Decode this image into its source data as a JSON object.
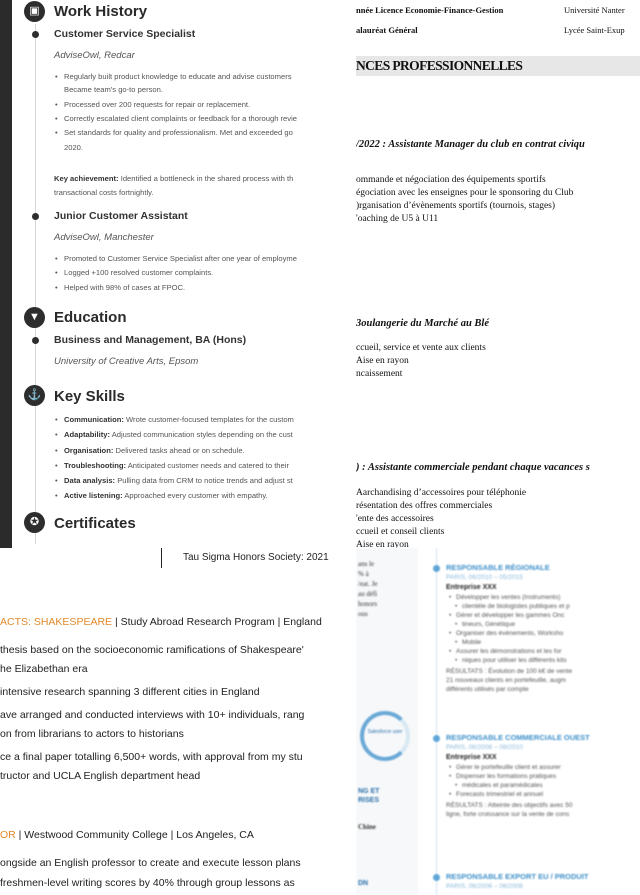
{
  "panelA": {
    "work": {
      "heading": "Work History",
      "job1": {
        "title": "Customer Service Specialist",
        "company": "AdviseOwl, Redcar",
        "bullets": [
          "Regularly built product knowledge to educate and advise customers",
          "Became team's go-to person.",
          "Processed over 200 requests for repair or replacement.",
          "Correctly escalated client complaints or feedback for a thorough revie",
          "Set standards for quality and professionalism. Met and exceeded go",
          "2020."
        ],
        "achievement_label": "Key achievement:",
        "achievement_text": "Identified a bottleneck in the shared process with th",
        "achievement_text2": "transactional costs fortnightly."
      },
      "job2": {
        "title": "Junior Customer Assistant",
        "company": "AdviseOwl, Manchester",
        "bullets": [
          "Promoted to Customer Service Specialist after one year of employme",
          "Logged +100 resolved customer complaints.",
          "Helped with 98% of cases at FPOC."
        ]
      }
    },
    "education": {
      "heading": "Education",
      "degree": "Business and Management, BA (Hons)",
      "school": "University of Creative Arts, Epsom"
    },
    "skills": {
      "heading": "Key Skills",
      "items": [
        {
          "label": "Communication:",
          "text": "Wrote customer-focused templates for the custom"
        },
        {
          "label": "Adaptability:",
          "text": "Adjusted communication styles depending on the cust"
        },
        {
          "label": "Organisation:",
          "text": "Delivered tasks ahead or on schedule."
        },
        {
          "label": "Troubleshooting:",
          "text": "Anticipated customer needs and catered to their"
        },
        {
          "label": "Data analysis:",
          "text": "Pulling data from CRM to notice trends and adjust st"
        },
        {
          "label": "Active listening:",
          "text": "Approached every customer with empathy."
        }
      ]
    },
    "certificates": {
      "heading": "Certificates"
    },
    "icons": {
      "work": "briefcase-icon",
      "education": "graduation-cap-icon",
      "skills": "anchor-icon",
      "certificates": "award-icon"
    }
  },
  "panelB": {
    "edu1_left": "nnée Licence Economie-Finance-Gestion",
    "edu1_right": "Université Nanter",
    "edu2_left": "alauréat Général",
    "edu2_right": "Lycée Saint-Exup",
    "section": "NCES PROFESSIONNELLES",
    "job1_title": "/2022 : Assistante Manager du club en contrat civiqu",
    "job1_lines": [
      "ommande et négociation des équipements sportifs",
      "égociation avec les enseignes pour le sponsoring du Club",
      ")rganisation d’évènements sportifs (tournois, stages)",
      "'oaching de U5 à U11"
    ],
    "job2_title": "3oulangerie du Marché au Blé",
    "job2_lines": [
      "ccueil, service et vente aux clients",
      "Aise en rayon",
      "ncaissement"
    ],
    "job3_title": ") : Assistante commerciale pendant chaque vacances s",
    "job3_lines": [
      "Aarchandising d’accessoires pour téléphonie",
      "résentation des offres commerciales",
      "'ente des accessoires",
      "ccueil et conseil clients",
      "Aise en rayon"
    ]
  },
  "panelC": {
    "honors": "Tau Sigma Honors Society: 2021",
    "role_accent": "ACTS: SHAKESPEARE",
    "role_rest": " | Study Abroad Research Program | England",
    "lines": [
      "thesis based on the socioeconomic ramifications of Shakespeare'",
      "he Elizabethan era",
      "intensive research spanning 3 different cities in England",
      "ave arranged and conducted interviews with 10+ individuals, rang",
      "on from librarians to actors to historians",
      "ce a final paper totalling 6,500+ words, with approval from my stu",
      "tructor and UCLA English department head"
    ],
    "role2_accent": "OR",
    "role2_rest": " | Westwood Community College | Los Angeles, CA",
    "lines2": [
      "ongside an English professor to create and execute lesson plans",
      "freshmen-level writing scores by 40% through group lessons as"
    ]
  },
  "panelD": {
    "sidebar_frags": [
      "ans le",
      "% à",
      "/eat. Je",
      "au défi",
      "honors",
      "ous"
    ],
    "circle_label": "Salesforce user",
    "sidebar_caps": [
      "NG ET",
      "RISES"
    ],
    "sidebar_more": [
      "Chine",
      "DN"
    ],
    "entries": [
      {
        "title": "RESPONSABLE RÉGIONALE",
        "dates": "PARIS, 06/2010 – 05/2015",
        "company": "Entreprise XXX",
        "bullets": [
          "Développer les ventes (Instruments)",
          "clientèle de biologistes publiques et p",
          "Gérer et développer les gammes Onc",
          "tineurs, Génétique",
          "Organiser des événements, Worksho",
          "Mobile",
          "Assurer les démonstrations et les for",
          "niques pour utiliser les différents kits"
        ],
        "result_lines": [
          "RÉSULTATS : Évolution de 100 k€ de vente",
          "21 nouveaux clients en portefeuille, augm",
          "différents utilisés par compte"
        ]
      },
      {
        "title": "RESPONSABLE COMMERCIALE OUEST",
        "dates": "PARIS, 06/2008 – 08/2010",
        "company": "Entreprise XXX",
        "bullets": [
          "Gérer le portefeuille client et assurer",
          "Dispenser les formations pratiques",
          "médicales et paramédicales",
          "Forecasts trimestriel et annuel"
        ],
        "result_lines": [
          "RÉSULTATS : Atteinte des objectifs avec 50",
          "ligne, forte croissance sur la vente de cons"
        ]
      },
      {
        "title": "RESPONSABLE EXPORT EU / PRODUIT",
        "dates": "PARIS, 06/2006 – 06/2008"
      }
    ]
  }
}
